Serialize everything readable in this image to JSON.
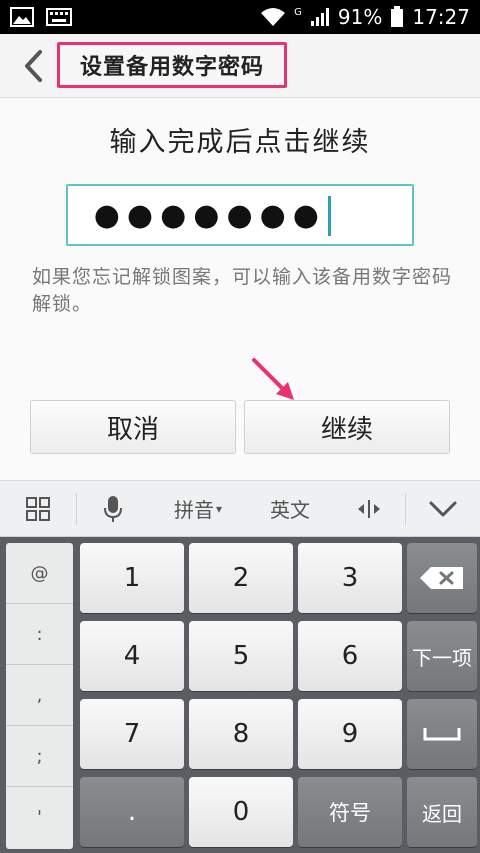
{
  "status": {
    "signal": "G",
    "battery": "91%",
    "time": "17:27"
  },
  "header": {
    "title": "设置备用数字密码"
  },
  "main": {
    "heading": "输入完成后点击继续",
    "password_mask": "●●●●●●●",
    "hint": "如果您忘记解锁图案，可以输入该备用数字密码解锁。",
    "cancel_label": "取消",
    "continue_label": "继续"
  },
  "keyboard_toolbar": {
    "pinyin": "拼音",
    "english": "英文"
  },
  "keyboard": {
    "symbols": [
      "@",
      ":",
      ",",
      ";",
      "'"
    ],
    "digits": [
      "1",
      "2",
      "3",
      "4",
      "5",
      "6",
      "7",
      "8",
      "9",
      "0"
    ],
    "dot": ".",
    "next_label": "下一项",
    "symbols_label": "符号",
    "return_label": "返回"
  },
  "colors": {
    "title_highlight": "#e8336d",
    "input_border": "#5ec3d1",
    "arrow": "#e8336d"
  }
}
